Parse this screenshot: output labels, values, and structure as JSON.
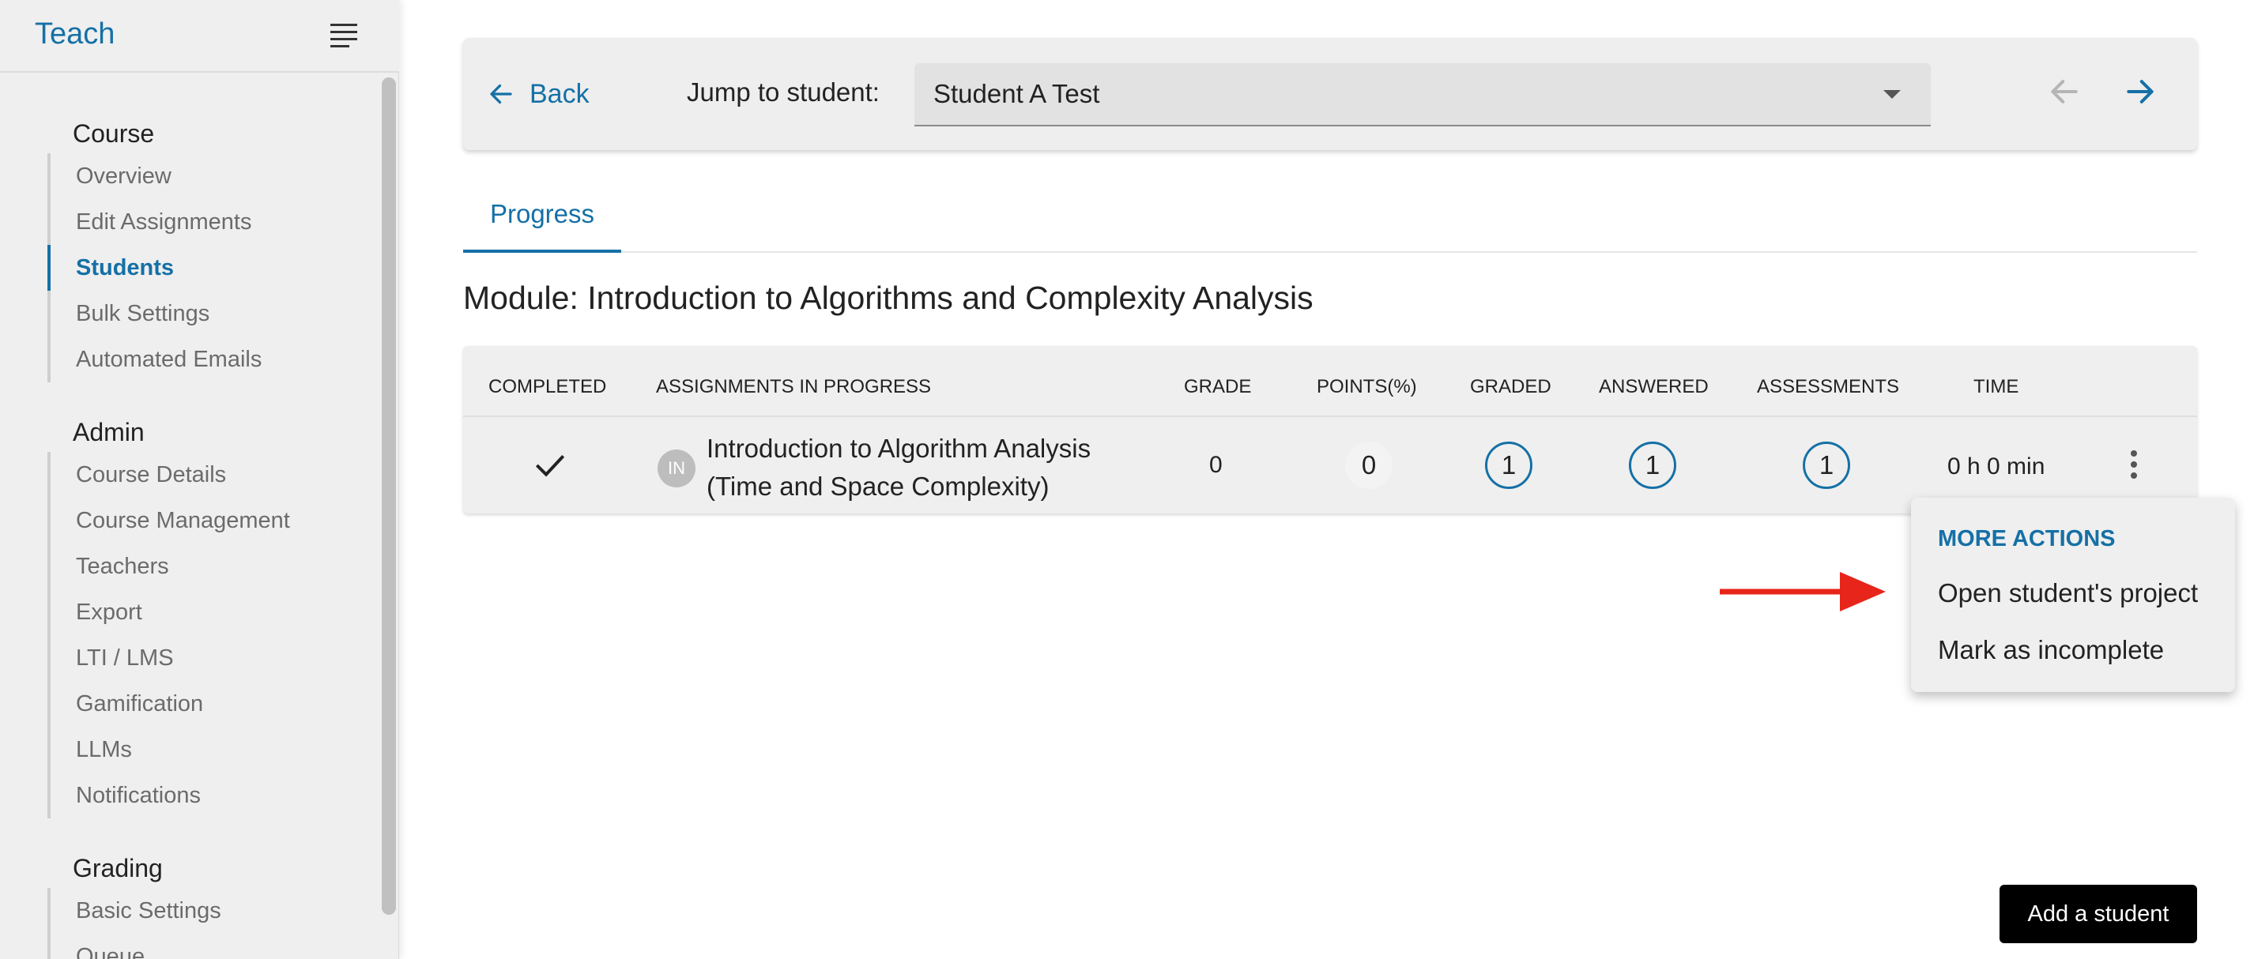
{
  "app": {
    "brand": "Teach"
  },
  "sidebar": {
    "sections": [
      {
        "heading": "Course",
        "items": [
          {
            "label": "Overview",
            "active": false
          },
          {
            "label": "Edit Assignments",
            "active": false
          },
          {
            "label": "Students",
            "active": true
          },
          {
            "label": "Bulk Settings",
            "active": false
          },
          {
            "label": "Automated Emails",
            "active": false
          }
        ]
      },
      {
        "heading": "Admin",
        "items": [
          {
            "label": "Course Details"
          },
          {
            "label": "Course Management"
          },
          {
            "label": "Teachers"
          },
          {
            "label": "Export"
          },
          {
            "label": "LTI / LMS"
          },
          {
            "label": "Gamification"
          },
          {
            "label": "LLMs"
          },
          {
            "label": "Notifications"
          }
        ]
      },
      {
        "heading": "Grading",
        "items": [
          {
            "label": "Basic Settings"
          },
          {
            "label": "Queue"
          }
        ]
      }
    ]
  },
  "toolbar": {
    "back_label": "Back",
    "jump_label": "Jump to student:",
    "selected_student": "Student A Test"
  },
  "tabs": [
    {
      "label": "Progress",
      "active": true
    }
  ],
  "module": {
    "title": "Module: Introduction to Algorithms and Complexity Analysis"
  },
  "table": {
    "headers": [
      "Completed",
      "Assignments in progress",
      "Grade",
      "Points(%)",
      "Graded",
      "Answered",
      "Assessments",
      "Time"
    ],
    "rows": [
      {
        "avatar": "IN",
        "assignment_line1": "Introduction to Algorithm Analysis",
        "assignment_line2": "(Time and Space Complexity)",
        "grade": "0",
        "points": "0",
        "graded": "1",
        "answered": "1",
        "assessments": "1",
        "time": "0 h 0 min"
      }
    ]
  },
  "menu": {
    "heading": "MORE ACTIONS",
    "items": [
      "Open student's project",
      "Mark as incomplete"
    ]
  },
  "add_student_label": "Add a student",
  "colors": {
    "accent": "#1570a6",
    "annotation": "#e8251a"
  }
}
